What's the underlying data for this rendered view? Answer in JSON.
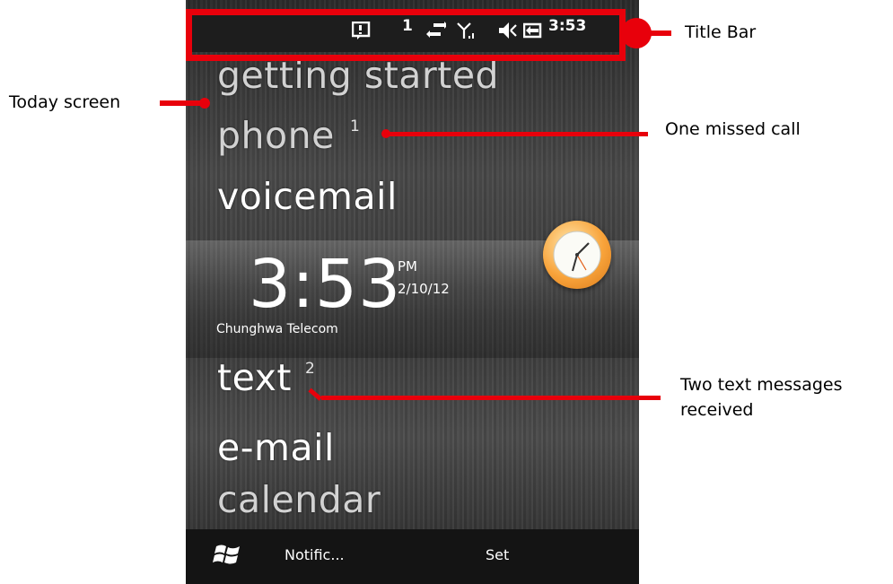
{
  "status_bar": {
    "signal_count": "1",
    "time": "3:53",
    "icons": [
      "notification-icon",
      "data-transfer-icon",
      "signal-icon",
      "speaker-muted-icon",
      "battery-charging-icon"
    ]
  },
  "today": {
    "items": [
      {
        "label": "getting started"
      },
      {
        "label": "phone",
        "badge": "1"
      },
      {
        "label": "voicemail"
      },
      {
        "label": "text",
        "badge": "2"
      },
      {
        "label": "e-mail"
      },
      {
        "label": "calendar"
      }
    ],
    "clock": {
      "time": "3:53",
      "ampm": "PM",
      "date": "2/10/12",
      "carrier": "Chunghwa Telecom"
    }
  },
  "softkeys": {
    "left": "Notific...",
    "right": "Set"
  },
  "annotations": {
    "title_bar": "Title Bar",
    "today_screen": "Today screen",
    "missed_call": "One missed call",
    "text_messages_line1": "Two text messages",
    "text_messages_line2": "received"
  },
  "colors": {
    "highlight": "#e8000b",
    "clock_orange": "#f8a33a"
  }
}
